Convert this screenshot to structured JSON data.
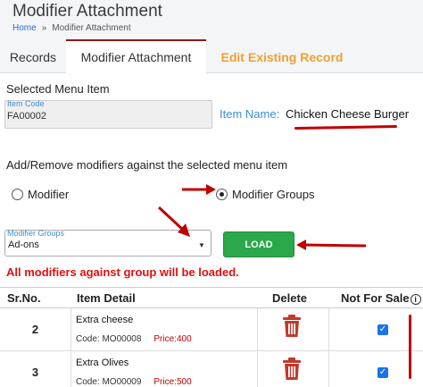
{
  "header": {
    "title": "Modifier Attachment",
    "breadcrumb": {
      "home": "Home",
      "separator": "»",
      "current": "Modifier Attachment"
    }
  },
  "tabs": [
    {
      "label": "Records",
      "active": false
    },
    {
      "label": "Modifier Attachment",
      "active": true
    },
    {
      "label": "Edit Existing Record",
      "active": false
    }
  ],
  "selected_menu_item": {
    "section_title": "Selected Menu Item",
    "item_code_label": "Item Code",
    "item_code": "FA00002",
    "item_name_label": "Item Name:",
    "item_name": "Chicken Cheese Burger"
  },
  "modifiers": {
    "section_title": "Add/Remove modifiers against the selected menu item",
    "options": [
      {
        "label": "Modifier",
        "checked": false
      },
      {
        "label": "Modifier Groups",
        "checked": true
      }
    ],
    "group_select_label": "Modifier Groups",
    "group_selected": "Ad-ons",
    "load_label": "LOAD",
    "warning": "All modifiers against group will be loaded."
  },
  "table": {
    "columns": [
      "Sr.No.",
      "Item Detail",
      "Delete",
      "Not For Sale"
    ],
    "code_prefix": "Code:",
    "price_prefix": "Price:",
    "rows": [
      {
        "sr": "2",
        "name": "Extra cheese",
        "code": "MO00008",
        "price": "400",
        "not_for_sale": true
      },
      {
        "sr": "3",
        "name": "Extra Olives",
        "code": "MO00009",
        "price": "500",
        "not_for_sale": true
      }
    ]
  },
  "colors": {
    "accent_red": "#c00000",
    "link_blue": "#2a6ebb",
    "load_green": "#2aa84a",
    "tab_orange": "#f0a030",
    "trash_red": "#c0392b"
  }
}
